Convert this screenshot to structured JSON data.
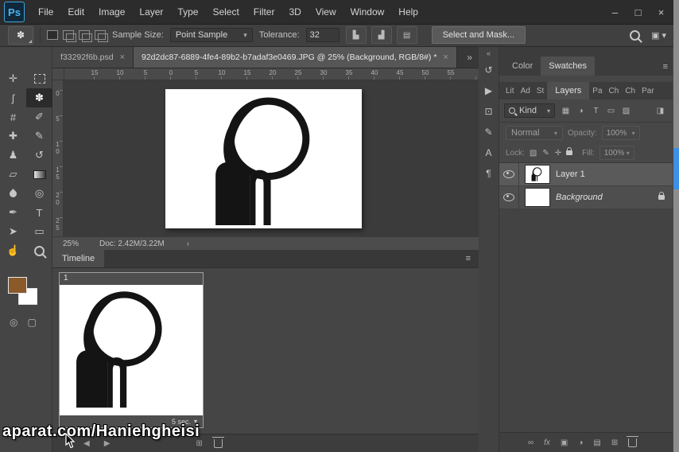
{
  "icons": {
    "caret": "▾",
    "menu": "≡",
    "collapse": "«"
  },
  "titlebar": {
    "logo": "Ps",
    "menus": [
      "File",
      "Edit",
      "Image",
      "Layer",
      "Type",
      "Select",
      "Filter",
      "3D",
      "View",
      "Window",
      "Help"
    ],
    "minimize": "–",
    "maximize": "□",
    "close": "×"
  },
  "options": {
    "tool_glyph": "✽",
    "sample_size_label": "Sample Size:",
    "sample_size_value": "Point Sample",
    "tolerance_label": "Tolerance:",
    "tolerance_value": "32",
    "aa_icons": [
      {
        "name": "histogram-icon",
        "glyph": "▙"
      },
      {
        "name": "histogram-alt-icon",
        "glyph": "▟"
      },
      {
        "name": "sample-layers-icon",
        "glyph": "▤"
      }
    ],
    "select_mask": "Select and Mask...",
    "workspace_glyph": "▣"
  },
  "tools": [
    {
      "name": "move-tool",
      "glyph": "✛"
    },
    {
      "name": "marquee-tool",
      "glyph": "",
      "cls": "css-marquee"
    },
    {
      "name": "lasso-tool",
      "glyph": "ʃ"
    },
    {
      "name": "magic-wand-tool",
      "glyph": "✽",
      "cls": "active"
    },
    {
      "name": "crop-tool",
      "glyph": "#"
    },
    {
      "name": "eyedropper-tool",
      "glyph": "✐"
    },
    {
      "name": "healing-brush-tool",
      "glyph": "✚"
    },
    {
      "name": "brush-tool",
      "glyph": "✎"
    },
    {
      "name": "clone-stamp-tool",
      "glyph": "♟"
    },
    {
      "name": "history-brush-tool",
      "glyph": "↺"
    },
    {
      "name": "eraser-tool",
      "glyph": "▱"
    },
    {
      "name": "gradient-tool",
      "glyph": "",
      "cls": "css-gradient"
    },
    {
      "name": "blur-tool",
      "glyph": "",
      "cls": "css-blur"
    },
    {
      "name": "dodge-tool",
      "glyph": "◎"
    },
    {
      "name": "pen-tool",
      "glyph": "✒"
    },
    {
      "name": "type-tool",
      "glyph": "T"
    },
    {
      "name": "path-select-tool",
      "glyph": "➤"
    },
    {
      "name": "shape-tool",
      "glyph": "▭"
    },
    {
      "name": "hand-tool",
      "glyph": "☝"
    },
    {
      "name": "zoom-tool",
      "glyph": "",
      "cls": "css-zoom"
    }
  ],
  "toolbar_bottom": [
    {
      "name": "quick-mask-icon",
      "glyph": "◎"
    },
    {
      "name": "screen-mode-icon",
      "glyph": "▢"
    }
  ],
  "doc_tabs": {
    "tab1": "f33292f6b.psd",
    "tab2": "92d2dc87-6889-4fe4-89b2-b7adaf3e0469.JPG @ 25% (Background, RGB/8#) *",
    "close": "×",
    "overflow": "»"
  },
  "rulers": {
    "h": [
      "15",
      "10",
      "5",
      "0",
      "5",
      "10",
      "15",
      "20",
      "25",
      "30",
      "35",
      "40",
      "45",
      "50",
      "55"
    ],
    "v": [
      "0",
      "5",
      "10",
      "15",
      "20",
      "25"
    ]
  },
  "status": {
    "zoom": "25%",
    "doc_size": "Doc: 2.42M/3.22M",
    "expander": "›"
  },
  "timeline": {
    "tab_label": "Timeline",
    "frame_number": "1",
    "frame_duration": "5 sec.",
    "footer_icons": [
      {
        "name": "loop-select-icon",
        "glyph": "▾"
      },
      {
        "name": "previous-frame-icon",
        "glyph": "◀"
      },
      {
        "name": "play-frames-icon",
        "glyph": "▶"
      }
    ],
    "frame_action_icons": [
      {
        "name": "duplicate-frame-icon",
        "glyph": "⊞"
      }
    ]
  },
  "dock": {
    "icons": [
      {
        "name": "history-panel-icon",
        "glyph": "↺"
      },
      {
        "name": "actions-panel-icon",
        "glyph": "▶"
      },
      {
        "name": "clone-source-panel-icon",
        "glyph": "⊡"
      },
      {
        "name": "brush-settings-panel-icon",
        "glyph": "✎"
      },
      {
        "name": "character-panel-icon",
        "glyph": "A"
      },
      {
        "name": "paragraph-panel-icon",
        "glyph": "¶"
      }
    ]
  },
  "right": {
    "tabs_row1": [
      "Color",
      "Swatches"
    ],
    "tabs_row2_left": [
      "Lit",
      "Ad",
      "St"
    ],
    "tabs_row2_active": "Layers",
    "tabs_row2_right": [
      "Pa",
      "Ch",
      "Ch",
      "Par"
    ],
    "layers": {
      "search_label": "Kind",
      "filter_icons": [
        {
          "name": "filter-pixel-icon",
          "glyph": "▦"
        },
        {
          "name": "filter-adjustment-icon",
          "glyph": "◑"
        },
        {
          "name": "filter-type-icon",
          "glyph": "T"
        },
        {
          "name": "filter-shape-icon",
          "glyph": "▭"
        },
        {
          "name": "filter-smart-icon",
          "glyph": "▨"
        },
        {
          "name": "filter-toggle-icon",
          "glyph": "◨"
        }
      ],
      "blend_mode": "Normal",
      "opacity_label": "Opacity:",
      "opacity_value": "100%",
      "lock_label": "Lock:",
      "lock_icons": [
        {
          "name": "lock-transparency-icon",
          "glyph": "▨"
        },
        {
          "name": "lock-pixels-icon",
          "glyph": "✎"
        },
        {
          "name": "lock-position-icon",
          "glyph": "✛"
        }
      ],
      "fill_label": "Fill:",
      "fill_value": "100%",
      "rows": [
        {
          "name": "Layer 1"
        },
        {
          "name": "Background"
        }
      ],
      "footer_icons": [
        {
          "name": "link-layers-icon",
          "glyph": "∞"
        },
        {
          "name": "layer-effects-icon",
          "glyph": "fx",
          "cls": "fx-italic"
        },
        {
          "name": "layer-mask-icon",
          "glyph": "▣"
        },
        {
          "name": "adjustment-layer-icon",
          "glyph": "◑"
        },
        {
          "name": "layer-group-icon",
          "glyph": "▤"
        },
        {
          "name": "new-layer-icon",
          "glyph": "⊞"
        }
      ]
    }
  },
  "watermark": "aparat.com/Haniehgheisi",
  "colors": {
    "accent": "#31a8ff",
    "foreground_swatch": "#8a5a2b",
    "background_swatch": "#ffffff",
    "scrollbar_thumb": "#3d8fe8"
  }
}
